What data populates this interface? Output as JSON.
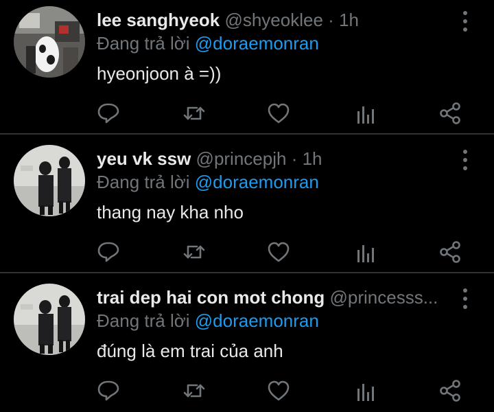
{
  "colors": {
    "background": "#000000",
    "text_primary": "#e7e9ea",
    "text_secondary": "#71767b",
    "accent": "#1d9bf0",
    "divider": "#2f3336"
  },
  "icons": {
    "more": "more-vertical-icon",
    "reply": "reply-bubble-icon",
    "retweet": "retweet-arrows-icon",
    "like": "heart-icon",
    "views": "analytics-bars-icon",
    "share": "share-nodes-icon"
  },
  "tweets": [
    {
      "display_name": "lee sanghyeok",
      "handle": "@shyeoklee",
      "separator": "·",
      "time": "1h",
      "replying_prefix": "Đang trả lời ",
      "replying_to": "@doraemonran",
      "text": "hyeonjoon à =))"
    },
    {
      "display_name": "yeu vk ssw",
      "handle": "@princepjh",
      "separator": "·",
      "time": "1h",
      "replying_prefix": "Đang trả lời ",
      "replying_to": "@doraemonran",
      "text": "thang nay kha nho"
    },
    {
      "display_name": "trai dep hai con mot chong",
      "handle": "@princesss...",
      "separator": "",
      "time": "",
      "replying_prefix": "Đang trả lời ",
      "replying_to": "@doraemonran",
      "text": "đúng là em trai của anh"
    }
  ]
}
